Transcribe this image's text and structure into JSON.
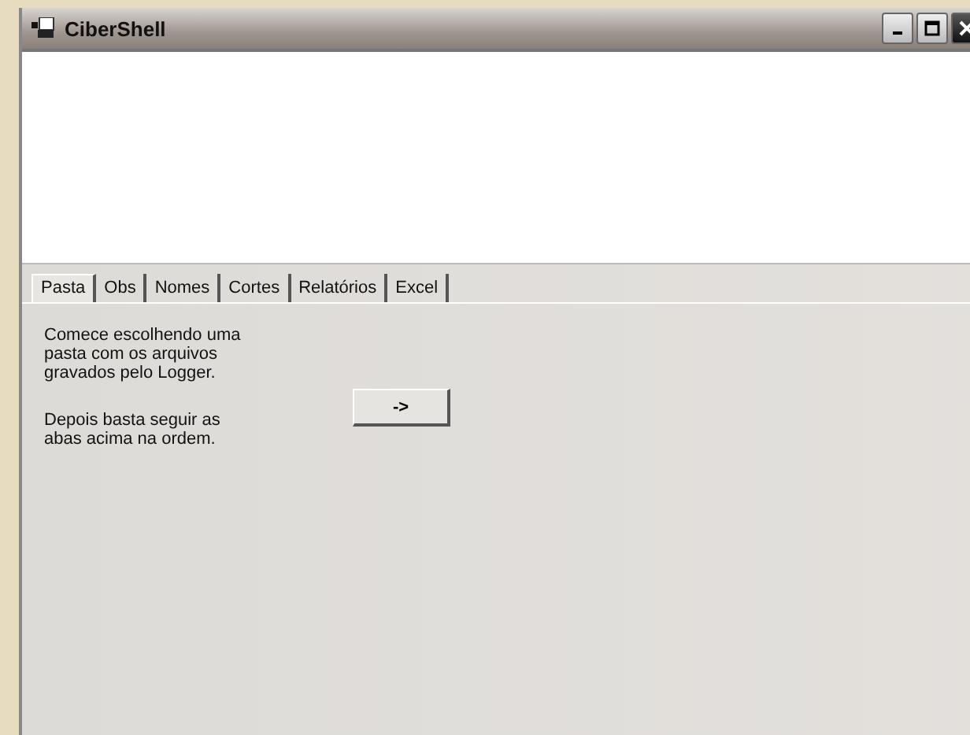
{
  "window": {
    "title": "CiberShell"
  },
  "tabs": [
    {
      "label": "Pasta",
      "selected": true
    },
    {
      "label": "Obs",
      "selected": false
    },
    {
      "label": "Nomes",
      "selected": false
    },
    {
      "label": "Cortes",
      "selected": false
    },
    {
      "label": "Relatórios",
      "selected": false
    },
    {
      "label": "Excel",
      "selected": false
    }
  ],
  "instructions": [
    "Comece escolhendo uma pasta com os arquivos gravados pelo Logger.",
    "Depois basta seguir as abas acima na ordem."
  ],
  "next_button": {
    "label": "->"
  }
}
